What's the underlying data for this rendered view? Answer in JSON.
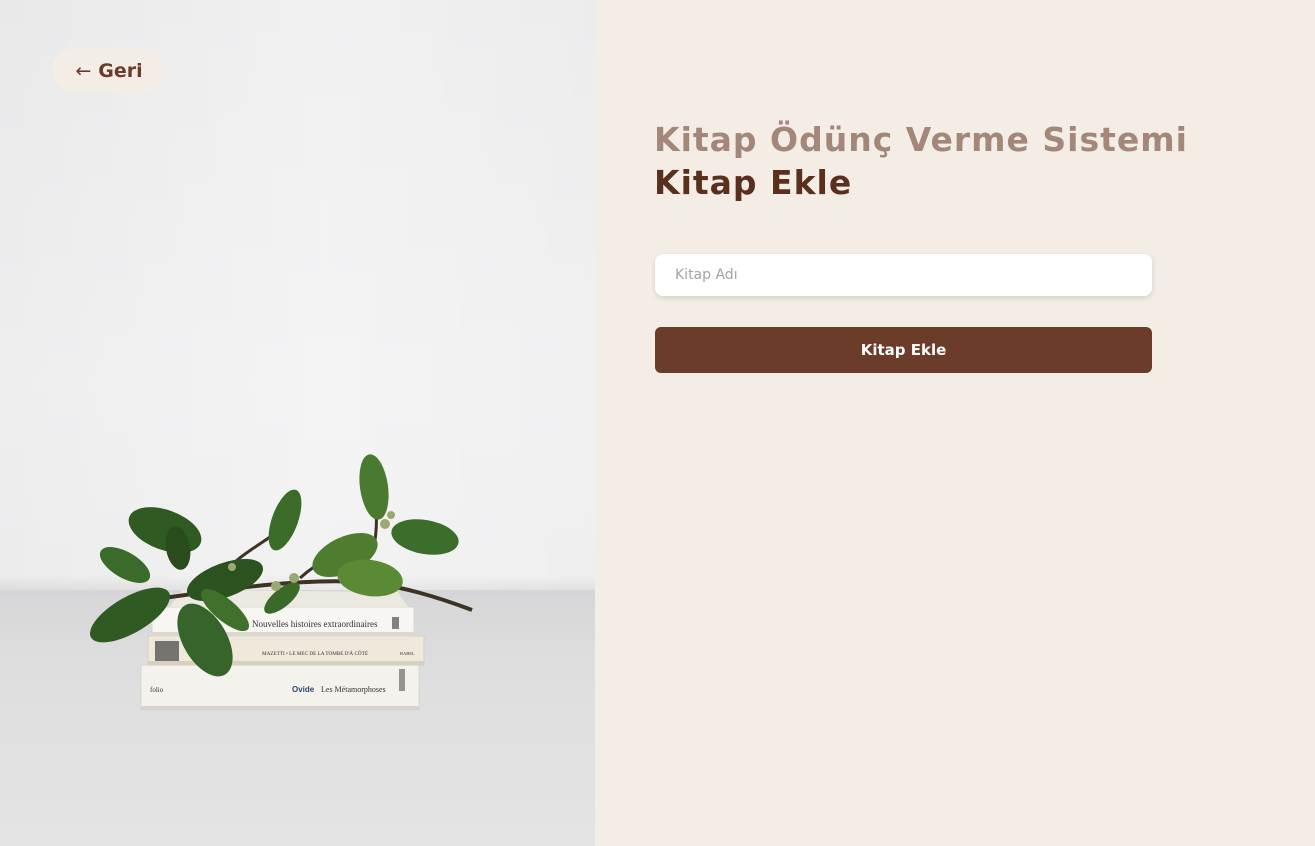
{
  "back": {
    "label": "Geri",
    "icon": "arrow-left-icon"
  },
  "header": {
    "system_title": "Kitap Ödünç Verme Sistemi",
    "page_title": "Kitap Ekle"
  },
  "form": {
    "book_name_placeholder": "Kitap Adı",
    "book_name_value": "",
    "submit_label": "Kitap Ekle"
  },
  "illustration": {
    "book_spines": [
      "Nouvelles histoires extraordinaires",
      "MAZETTI • LE MEC DE LA TOMBE D'À CÔTÉ",
      "BABEL",
      "folio",
      "Ovide",
      "Les Métamorphoses"
    ]
  },
  "colors": {
    "accent": "#6b3c2a",
    "title_primary": "#5b2f1d",
    "title_secondary": "#a38779",
    "background": "#f3ede6"
  }
}
